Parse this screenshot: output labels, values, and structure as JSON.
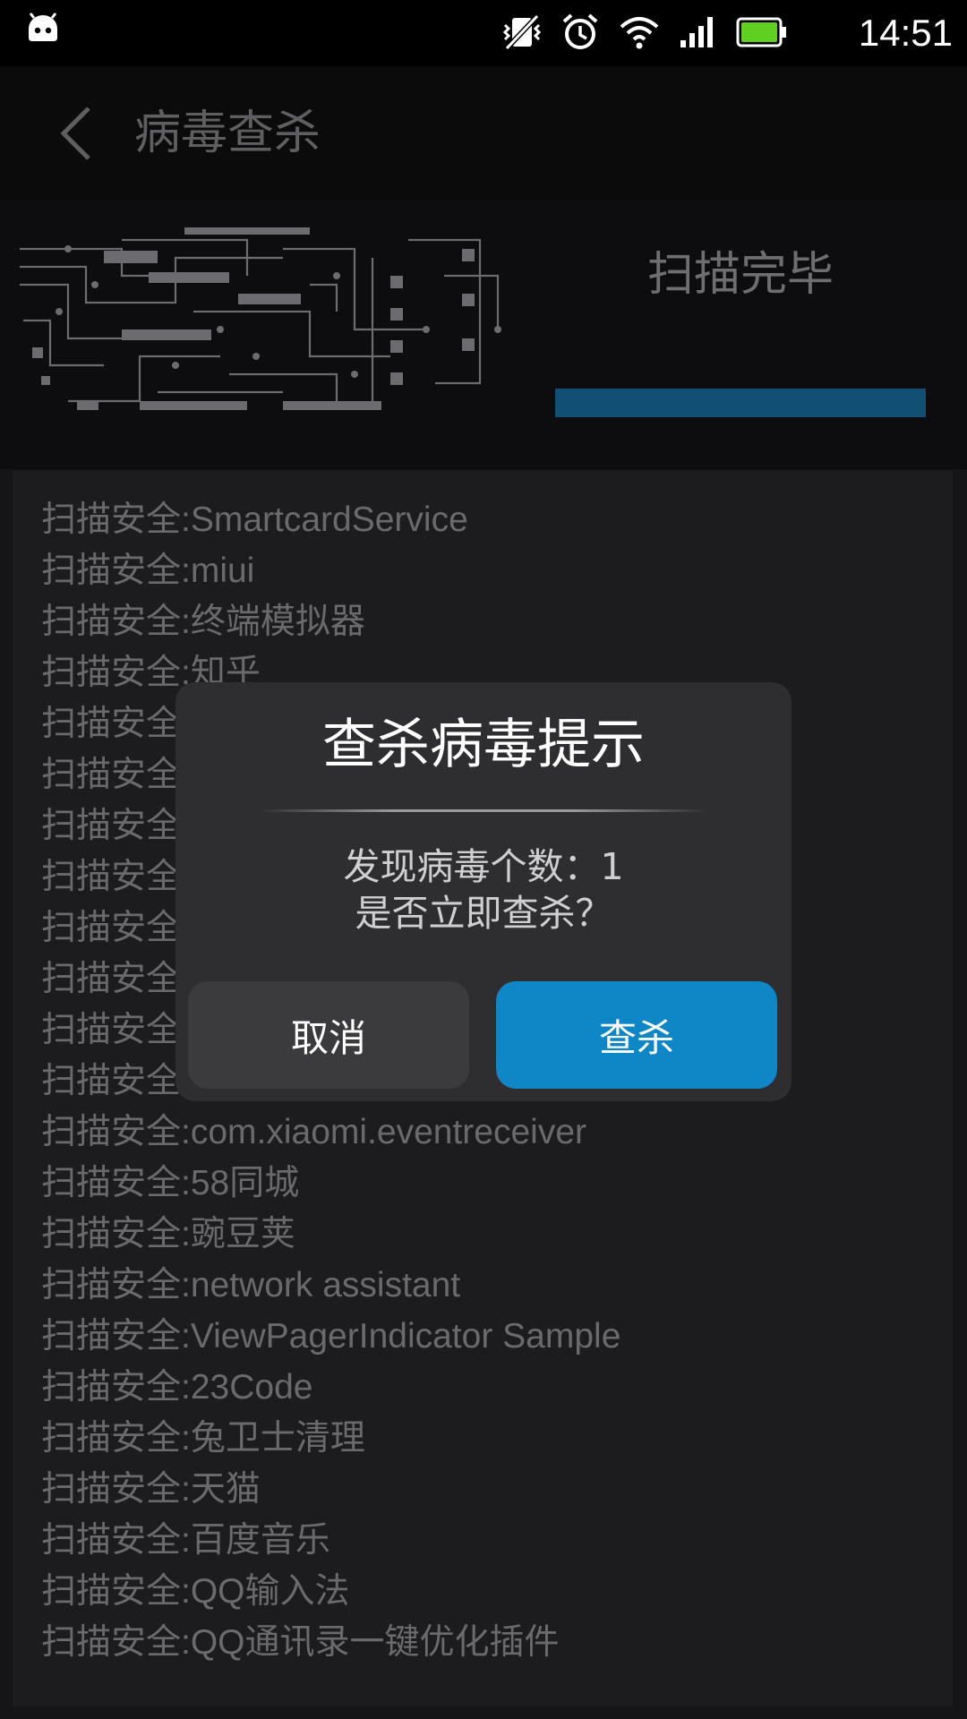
{
  "statusbar": {
    "time": "14:51",
    "icons": [
      "android-icon",
      "vibrate-off-icon",
      "alarm-icon",
      "wifi-icon",
      "signal-icon",
      "battery-icon"
    ],
    "battery_color": "#5fd01f"
  },
  "header": {
    "title": "病毒查杀"
  },
  "scan": {
    "status": "扫描完毕",
    "progress": 1.0,
    "progress_color": "#124f74"
  },
  "scan_list": {
    "items": [
      "扫描安全:SmartcardService",
      "扫描安全:miui",
      "扫描安全:终端模拟器",
      "扫描安全:知乎",
      "扫描安全",
      "扫描安全",
      "扫描安全",
      "扫描安全",
      "扫描安全",
      "扫描安全",
      "扫描安全",
      "扫描安全",
      "扫描安全:com.xiaomi.eventreceiver",
      "扫描安全:58同城",
      "扫描安全:豌豆荚",
      "扫描安全:network assistant",
      "扫描安全:ViewPagerIndicator Sample",
      "扫描安全:23Code",
      "扫描安全:兔卫士清理",
      "扫描安全:天猫",
      "扫描安全:百度音乐",
      "扫描安全:QQ输入法",
      "扫描安全:QQ通讯录一键优化插件"
    ]
  },
  "dialog": {
    "title": "查杀病毒提示",
    "message_line1": "发现病毒个数：1",
    "message_line2": "是否立即查杀？",
    "cancel_label": "取消",
    "confirm_label": "查杀",
    "confirm_color": "#0f87c6"
  }
}
